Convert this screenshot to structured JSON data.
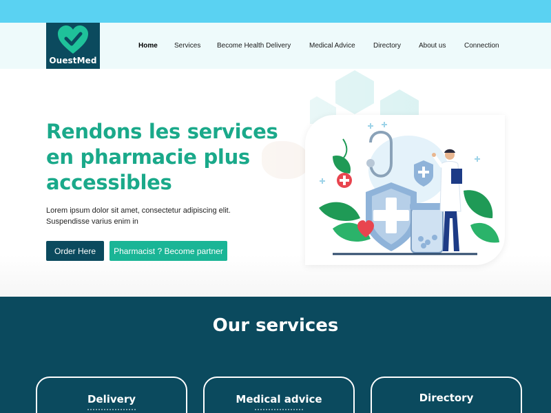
{
  "brand": {
    "name": "OuestMed",
    "logo_icon": "heart-check-icon",
    "primary_color": "#0b4a5e",
    "accent_color": "#1ab596",
    "top_bar_color": "#5ad2f2"
  },
  "nav": {
    "items": [
      {
        "label": "Home",
        "active": true
      },
      {
        "label": "Services",
        "active": false
      },
      {
        "label": "Become Health Delivery",
        "active": false
      },
      {
        "label": "Medical Advice",
        "active": false
      },
      {
        "label": "Directory",
        "active": false
      },
      {
        "label": "About us",
        "active": false
      },
      {
        "label": "Connection",
        "active": false
      }
    ]
  },
  "hero": {
    "title": "Rendons les services en pharmacie plus accessibles",
    "text": "Lorem ipsum dolor sit amet, consectetur adipiscing elit. Suspendisse varius enim in",
    "order_button": "Order Here",
    "partner_button": "Pharmacist ? Become partner",
    "illustration": "doctor-medical-shield-illustration"
  },
  "services": {
    "title": "Our services",
    "cards": [
      {
        "title": "Delivery"
      },
      {
        "title": "Medical advice"
      },
      {
        "title": "Directory"
      }
    ]
  }
}
